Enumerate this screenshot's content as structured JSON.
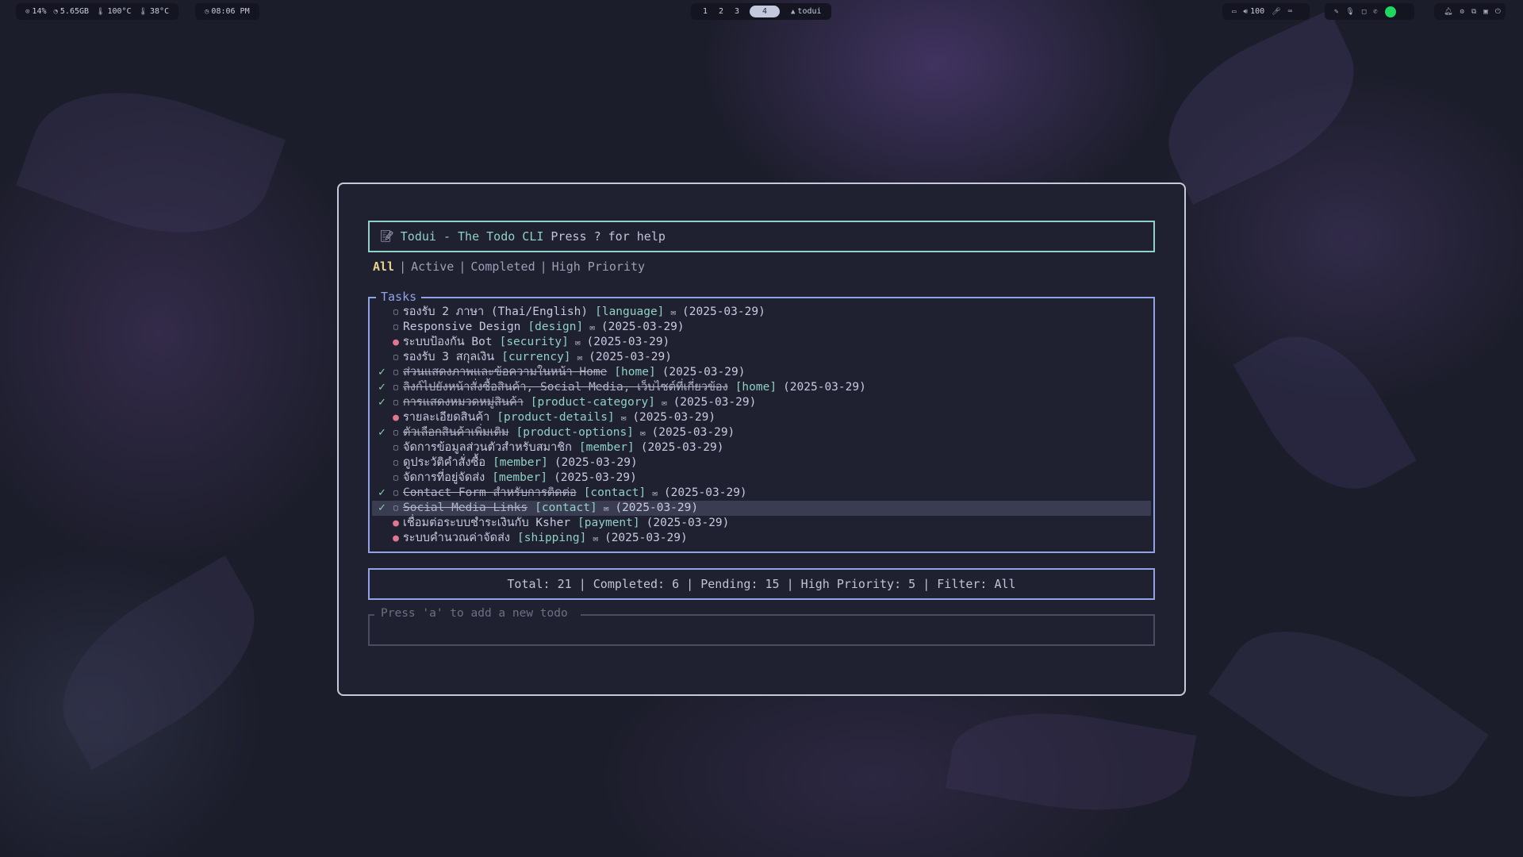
{
  "topbar": {
    "cpu": "14%",
    "memory": "5.65GB",
    "gpu_temp": "100°C",
    "cpu_temp": "38°C",
    "clock": "08:06 PM",
    "workspaces": [
      "1",
      "2",
      "3",
      "4"
    ],
    "active_workspace": "4",
    "window_title": "todui",
    "volume": "100"
  },
  "app": {
    "title_icon": "memo-icon",
    "title": "Todui - The Todo CLI",
    "help_hint": "Press ? for help",
    "filters": [
      "All",
      "Active",
      "Completed",
      "High Priority"
    ],
    "selected_filter": "All",
    "tasks_label": "Tasks",
    "tasks": [
      {
        "done": false,
        "priority": "low",
        "title": "รองรับ 2 ภาษา (Thai/English)",
        "tag": "[language]",
        "note": true,
        "date": "(2025-03-29)",
        "selected": false
      },
      {
        "done": false,
        "priority": "low",
        "title": "Responsive Design",
        "tag": "[design]",
        "note": true,
        "date": "(2025-03-29)",
        "selected": false
      },
      {
        "done": false,
        "priority": "high",
        "title": "ระบบป้องกัน Bot",
        "tag": "[security]",
        "note": true,
        "date": "(2025-03-29)",
        "selected": false
      },
      {
        "done": false,
        "priority": "low",
        "title": "รองรับ 3 สกุลเงิน",
        "tag": "[currency]",
        "note": true,
        "date": "(2025-03-29)",
        "selected": false
      },
      {
        "done": true,
        "priority": "low",
        "title": "ส่วนแสดงภาพและข้อความในหน้า Home",
        "tag": "[home]",
        "note": false,
        "date": "(2025-03-29)",
        "selected": false
      },
      {
        "done": true,
        "priority": "low",
        "title": "ลิงก์ไปยังหน้าสั่งซื้อสินค้า, Social Media, เว็บไซต์ที่เกี่ยวข้อง",
        "tag": "[home]",
        "note": false,
        "date": "(2025-03-29)",
        "selected": false
      },
      {
        "done": true,
        "priority": "low",
        "title": "การแสดงหมวดหมู่สินค้า",
        "tag": "[product-category]",
        "note": true,
        "date": "(2025-03-29)",
        "selected": false
      },
      {
        "done": false,
        "priority": "high",
        "title": "รายละเอียดสินค้า",
        "tag": "[product-details]",
        "note": true,
        "date": "(2025-03-29)",
        "selected": false
      },
      {
        "done": true,
        "priority": "low",
        "title": "ตัวเลือกสินค้าเพิ่มเติม",
        "tag": "[product-options]",
        "note": true,
        "date": "(2025-03-29)",
        "selected": false
      },
      {
        "done": false,
        "priority": "low",
        "title": "จัดการข้อมูลส่วนตัวสำหรับสมาชิก",
        "tag": "[member]",
        "note": false,
        "date": "(2025-03-29)",
        "selected": false
      },
      {
        "done": false,
        "priority": "low",
        "title": "ดูประวัติคำสั่งซื้อ",
        "tag": "[member]",
        "note": false,
        "date": "(2025-03-29)",
        "selected": false
      },
      {
        "done": false,
        "priority": "low",
        "title": "จัดการที่อยู่จัดส่ง",
        "tag": "[member]",
        "note": false,
        "date": "(2025-03-29)",
        "selected": false
      },
      {
        "done": true,
        "priority": "low",
        "title": "Contact Form สำหรับการติดต่อ",
        "tag": "[contact]",
        "note": true,
        "date": "(2025-03-29)",
        "selected": false
      },
      {
        "done": true,
        "priority": "low",
        "title": "Social Media Links",
        "tag": "[contact]",
        "note": true,
        "date": "(2025-03-29)",
        "selected": true
      },
      {
        "done": false,
        "priority": "high",
        "title": "เชื่อมต่อระบบชำระเงินกับ Ksher",
        "tag": "[payment]",
        "note": false,
        "date": "(2025-03-29)",
        "selected": false
      },
      {
        "done": false,
        "priority": "high",
        "title": "ระบบคำนวณค่าจัดส่ง",
        "tag": "[shipping]",
        "note": true,
        "date": "(2025-03-29)",
        "selected": false
      }
    ],
    "stats": "Total: 21 | Completed: 6 | Pending: 15 | High Priority: 5 | Filter: All",
    "input_placeholder": "Press 'a' to add a new todo"
  }
}
